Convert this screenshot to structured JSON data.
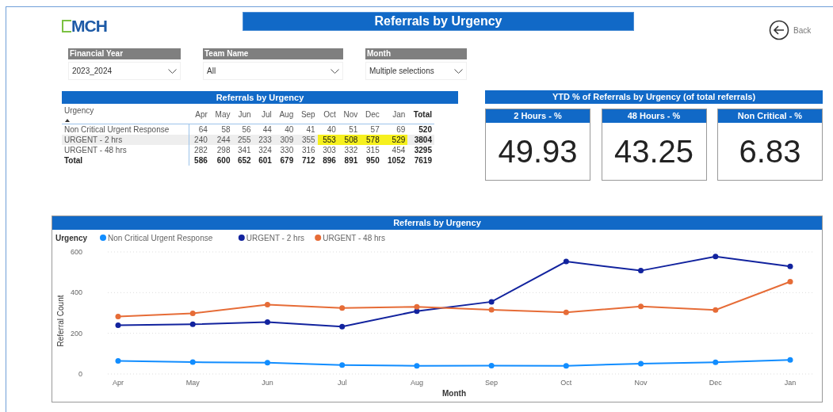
{
  "logo": {
    "text": "MCH"
  },
  "title": "Referrals by Urgency",
  "back": {
    "label": "Back"
  },
  "slicers": [
    {
      "label": "Financial Year",
      "value": "2023_2024"
    },
    {
      "label": "Team Name",
      "value": "All"
    },
    {
      "label": "Month",
      "value": "Multiple selections"
    }
  ],
  "table": {
    "title": "Referrals by Urgency",
    "columns": [
      "Urgency",
      "Apr",
      "May",
      "Jun",
      "Jul",
      "Aug",
      "Sep",
      "Oct",
      "Nov",
      "Dec",
      "Jan",
      "Total"
    ],
    "rows": [
      {
        "kind": "data",
        "selected": false,
        "label": "Non Critical Urgent Response",
        "values": [
          "64",
          "58",
          "56",
          "44",
          "40",
          "41",
          "40",
          "51",
          "57",
          "69"
        ],
        "total": "520",
        "highlighted": [
          false,
          false,
          false,
          false,
          false,
          false,
          false,
          false,
          false,
          false
        ]
      },
      {
        "kind": "data",
        "selected": true,
        "label": "URGENT - 2 hrs",
        "values": [
          "240",
          "244",
          "255",
          "233",
          "309",
          "355",
          "553",
          "508",
          "578",
          "529"
        ],
        "total": "3804",
        "highlighted": [
          false,
          false,
          false,
          false,
          false,
          false,
          true,
          true,
          true,
          true
        ]
      },
      {
        "kind": "data",
        "selected": false,
        "label": "URGENT - 48 hrs",
        "values": [
          "282",
          "298",
          "341",
          "324",
          "330",
          "316",
          "303",
          "332",
          "315",
          "454"
        ],
        "total": "3295",
        "highlighted": [
          false,
          false,
          false,
          false,
          false,
          false,
          false,
          false,
          false,
          false
        ]
      },
      {
        "kind": "total",
        "selected": false,
        "label": "Total",
        "values": [
          "586",
          "600",
          "652",
          "601",
          "679",
          "712",
          "896",
          "891",
          "950",
          "1052"
        ],
        "total": "7619",
        "highlighted": [
          false,
          false,
          false,
          false,
          false,
          false,
          false,
          false,
          false,
          false
        ]
      }
    ]
  },
  "kpis": {
    "title": "YTD % of Referrals by Urgency (of total referrals)",
    "cards": [
      {
        "label": "2 Hours - %",
        "value": "49.93"
      },
      {
        "label": "48 Hours - %",
        "value": "43.25"
      },
      {
        "label": "Non Critical - %",
        "value": "6.83"
      }
    ]
  },
  "chart": {
    "title": "Referrals by Urgency",
    "legend_title": "Urgency",
    "chart_data": {
      "type": "line",
      "xlabel": "Month",
      "ylabel": "Referral Count",
      "categories": [
        "Apr",
        "May",
        "Jun",
        "Jul",
        "Aug",
        "Sep",
        "Oct",
        "Nov",
        "Dec",
        "Jan"
      ],
      "legend": true,
      "ylim": [
        0,
        600
      ],
      "yticks": [
        {
          "value": 0,
          "label": "0"
        },
        {
          "value": 200,
          "label": "200"
        },
        {
          "value": 400,
          "label": "400"
        },
        {
          "value": 600,
          "label": "600"
        }
      ],
      "series": [
        {
          "name": "Non Critical Urgent Response",
          "color": "#118dff",
          "marker": true,
          "values": [
            64,
            58,
            56,
            44,
            40,
            41,
            40,
            51,
            57,
            69
          ]
        },
        {
          "name": "URGENT - 2 hrs",
          "color": "#12239e",
          "marker": true,
          "values": [
            240,
            244,
            255,
            233,
            309,
            355,
            553,
            508,
            578,
            529
          ]
        },
        {
          "name": "URGENT - 48 hrs",
          "color": "#e66c37",
          "marker": true,
          "values": [
            282,
            298,
            341,
            324,
            330,
            316,
            303,
            332,
            315,
            454
          ]
        }
      ]
    }
  }
}
